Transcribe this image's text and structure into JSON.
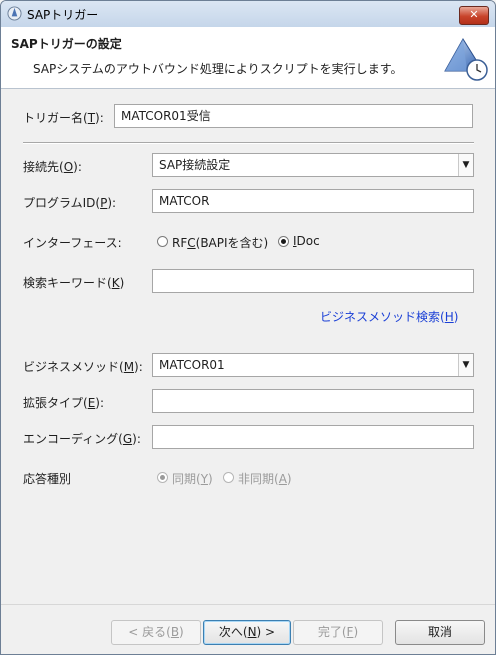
{
  "window": {
    "title": "SAPトリガー",
    "close": "✕"
  },
  "header": {
    "title": "SAPトリガーの設定",
    "subtitle": "SAPシステムのアウトバウンド処理によりスクリプトを実行します。"
  },
  "form": {
    "trigger_name": {
      "label": "トリガー名(",
      "key": "T",
      "suffix": "):",
      "value": "MATCOR01受信"
    },
    "connection": {
      "label": "接続先(",
      "key": "O",
      "suffix": "):",
      "value": "SAP接続設定"
    },
    "program_id": {
      "label": "プログラムID(",
      "key": "P",
      "suffix": "):",
      "value": "MATCOR"
    },
    "interface": {
      "label": "インターフェース:",
      "rfc_pre": "RF",
      "rfc_key": "C",
      "rfc_post": "(BAPIを含む)",
      "idoc_key": "I",
      "idoc_post": "Doc",
      "selected": "IDoc"
    },
    "search_keyword": {
      "label": "検索キーワード(",
      "key": "K",
      "suffix": ")",
      "value": ""
    },
    "business_method_search": {
      "label": "ビジネスメソッド検索(",
      "key": "H",
      "suffix": ")"
    },
    "business_method": {
      "label": "ビジネスメソッド(",
      "key": "M",
      "suffix": "):",
      "value": "MATCOR01"
    },
    "extension_type": {
      "label": "拡張タイプ(",
      "key": "E",
      "suffix": "):",
      "value": ""
    },
    "encoding": {
      "label": "エンコーディング(",
      "key": "G",
      "suffix": "):",
      "value": ""
    },
    "response": {
      "label": "応答種別",
      "sync_pre": "同期(",
      "sync_key": "Y",
      "sync_post": ")",
      "async_pre": "非同期(",
      "async_key": "A",
      "async_post": ")",
      "selected": "同期"
    }
  },
  "buttons": {
    "back": {
      "pre": "< 戻る(",
      "key": "B",
      "post": ")"
    },
    "next": {
      "pre": "次へ(",
      "key": "N",
      "post": ") >"
    },
    "finish": {
      "pre": "完了(",
      "key": "F",
      "post": ")"
    },
    "cancel": "取消"
  }
}
